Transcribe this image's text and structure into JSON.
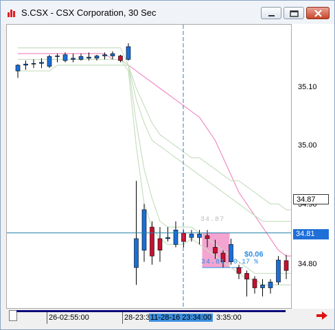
{
  "window": {
    "title": "S.CSX - CSX Corporation, 30 Sec"
  },
  "axis": {
    "y_labels": [
      "35.10",
      "35.00",
      "34.90",
      "34.80"
    ],
    "crosshair_price": "34.87",
    "last_price": "34.81",
    "price_colors": {
      "crosshair_box": "#ffffff",
      "last_box": "#1e6fd8"
    }
  },
  "time_axis": {
    "labels": [
      "26-02:55:00",
      "28-23:3",
      "11-28-16 23:34:00",
      "3:35:00"
    ]
  },
  "measure": {
    "start_price": "34.87",
    "end_price": "34.81",
    "change": "$0.06",
    "pct": "0.17 %"
  },
  "chart_data": {
    "type": "candlestick",
    "title": "S.CSX - CSX Corporation, 30 Sec",
    "ylim": [
      34.74,
      35.23
    ],
    "grid": false,
    "candles": [
      {
        "o": 35.15,
        "h": 35.162,
        "l": 35.138,
        "c": 35.16,
        "dir": "up"
      },
      {
        "o": 35.16,
        "h": 35.168,
        "l": 35.152,
        "c": 35.162,
        "dir": "up"
      },
      {
        "o": 35.162,
        "h": 35.17,
        "l": 35.155,
        "c": 35.163,
        "dir": "up"
      },
      {
        "o": 35.163,
        "h": 35.172,
        "l": 35.155,
        "c": 35.165,
        "dir": "up"
      },
      {
        "o": 35.158,
        "h": 35.178,
        "l": 35.155,
        "c": 35.175,
        "dir": "up"
      },
      {
        "o": 35.175,
        "h": 35.18,
        "l": 35.165,
        "c": 35.176,
        "dir": "up"
      },
      {
        "o": 35.168,
        "h": 35.182,
        "l": 35.165,
        "c": 35.178,
        "dir": "up"
      },
      {
        "o": 35.17,
        "h": 35.18,
        "l": 35.165,
        "c": 35.172,
        "dir": "up"
      },
      {
        "o": 35.17,
        "h": 35.18,
        "l": 35.168,
        "c": 35.175,
        "dir": "up"
      },
      {
        "o": 35.172,
        "h": 35.182,
        "l": 35.168,
        "c": 35.174,
        "dir": "up"
      },
      {
        "o": 35.172,
        "h": 35.178,
        "l": 35.168,
        "c": 35.176,
        "dir": "up"
      },
      {
        "o": 35.176,
        "h": 35.182,
        "l": 35.17,
        "c": 35.178,
        "dir": "up"
      },
      {
        "o": 35.176,
        "h": 35.184,
        "l": 35.17,
        "c": 35.18,
        "dir": "up"
      },
      {
        "o": 35.176,
        "h": 35.178,
        "l": 35.165,
        "c": 35.168,
        "dir": "down"
      },
      {
        "o": 35.17,
        "h": 35.198,
        "l": 35.168,
        "c": 35.192,
        "dir": "up"
      },
      {
        "o": 34.81,
        "h": 34.96,
        "l": 34.78,
        "c": 34.86,
        "dir": "up"
      },
      {
        "o": 34.84,
        "h": 34.92,
        "l": 34.82,
        "c": 34.91,
        "dir": "up"
      },
      {
        "o": 34.88,
        "h": 34.89,
        "l": 34.815,
        "c": 34.83,
        "dir": "down"
      },
      {
        "o": 34.86,
        "h": 34.88,
        "l": 34.82,
        "c": 34.84,
        "dir": "down"
      },
      {
        "o": 34.86,
        "h": 34.88,
        "l": 34.855,
        "c": 34.862,
        "dir": "up"
      },
      {
        "o": 34.85,
        "h": 34.89,
        "l": 34.845,
        "c": 34.875,
        "dir": "up"
      },
      {
        "o": 34.87,
        "h": 34.875,
        "l": 34.845,
        "c": 34.855,
        "dir": "down"
      },
      {
        "o": 34.862,
        "h": 34.875,
        "l": 34.855,
        "c": 34.868,
        "dir": "up"
      },
      {
        "o": 34.862,
        "h": 34.875,
        "l": 34.85,
        "c": 34.868,
        "dir": "up"
      },
      {
        "o": 34.865,
        "h": 34.875,
        "l": 34.845,
        "c": 34.86,
        "dir": "down"
      },
      {
        "o": 34.845,
        "h": 34.858,
        "l": 34.825,
        "c": 34.835,
        "dir": "down"
      },
      {
        "o": 34.835,
        "h": 34.84,
        "l": 34.81,
        "c": 34.82,
        "dir": "down"
      },
      {
        "o": 34.82,
        "h": 34.86,
        "l": 34.815,
        "c": 34.85,
        "dir": "up"
      },
      {
        "o": 34.81,
        "h": 34.815,
        "l": 34.79,
        "c": 34.8,
        "dir": "down"
      },
      {
        "o": 34.8,
        "h": 34.805,
        "l": 34.76,
        "c": 34.79,
        "dir": "down"
      },
      {
        "o": 34.79,
        "h": 34.795,
        "l": 34.765,
        "c": 34.775,
        "dir": "down"
      },
      {
        "o": 34.775,
        "h": 34.79,
        "l": 34.76,
        "c": 34.78,
        "dir": "up"
      },
      {
        "o": 34.775,
        "h": 34.79,
        "l": 34.765,
        "c": 34.785,
        "dir": "up"
      },
      {
        "o": 34.785,
        "h": 34.83,
        "l": 34.78,
        "c": 34.823,
        "dir": "up"
      },
      {
        "o": 34.822,
        "h": 34.832,
        "l": 34.79,
        "c": 34.805,
        "dir": "down"
      }
    ],
    "series": [
      {
        "color": "#f08cc4",
        "values": [
          35.18,
          35.18,
          35.18,
          35.18,
          35.18,
          35.18,
          35.18,
          35.18,
          35.18,
          35.18,
          35.18,
          35.18,
          35.17,
          35.17,
          35.16,
          35.15,
          35.14,
          35.13,
          35.12,
          35.11,
          35.1,
          35.09,
          35.08,
          35.07,
          35.05,
          35.03,
          35.0,
          34.97,
          34.94,
          34.92,
          34.9,
          34.88,
          34.86,
          34.84,
          34.83
        ]
      },
      {
        "color": "#c7dfc0",
        "values": [
          35.17,
          35.17,
          35.17,
          35.17,
          35.17,
          35.17,
          35.17,
          35.17,
          35.17,
          35.17,
          35.17,
          35.17,
          35.17,
          35.17,
          35.16,
          35.12,
          35.09,
          35.06,
          35.04,
          35.03,
          35.02,
          35.01,
          35.0,
          35.0,
          34.99,
          34.98,
          34.97,
          34.96,
          34.96,
          34.95,
          34.94,
          34.93,
          34.92,
          34.92,
          34.91
        ]
      },
      {
        "color": "#c7dfc0",
        "values": [
          35.15,
          35.15,
          35.15,
          35.15,
          35.15,
          35.16,
          35.16,
          35.16,
          35.16,
          35.16,
          35.16,
          35.16,
          35.16,
          35.16,
          35.16,
          35.1,
          35.06,
          35.03,
          35.02,
          35.01,
          35.0,
          34.99,
          34.98,
          34.97,
          34.96,
          34.95,
          34.94,
          34.93,
          34.92,
          34.91,
          34.9,
          34.89,
          34.89,
          34.89,
          34.89
        ]
      },
      {
        "color": "#c7dfc0",
        "values": [
          35.19,
          35.19,
          35.19,
          35.19,
          35.19,
          35.19,
          35.19,
          35.19,
          35.19,
          35.19,
          35.19,
          35.19,
          35.19,
          35.19,
          35.16,
          35.06,
          34.98,
          34.93,
          34.89,
          34.88,
          34.88,
          34.88,
          34.88,
          34.87,
          34.86,
          34.85,
          34.84,
          34.83,
          34.82,
          34.81,
          34.8,
          34.8,
          34.8,
          34.8,
          34.8
        ]
      },
      {
        "color": "#c7dfc0",
        "values": [
          35.17,
          35.17,
          35.17,
          35.17,
          35.17,
          35.17,
          35.17,
          35.17,
          35.17,
          35.17,
          35.17,
          35.17,
          35.17,
          35.17,
          35.15,
          35.02,
          34.92,
          34.88,
          34.86,
          34.85,
          34.85,
          34.85,
          34.86,
          34.85,
          34.84,
          34.83,
          34.82,
          34.81,
          34.8,
          34.79,
          34.79,
          34.78,
          34.78,
          34.78,
          34.78
        ]
      }
    ]
  }
}
